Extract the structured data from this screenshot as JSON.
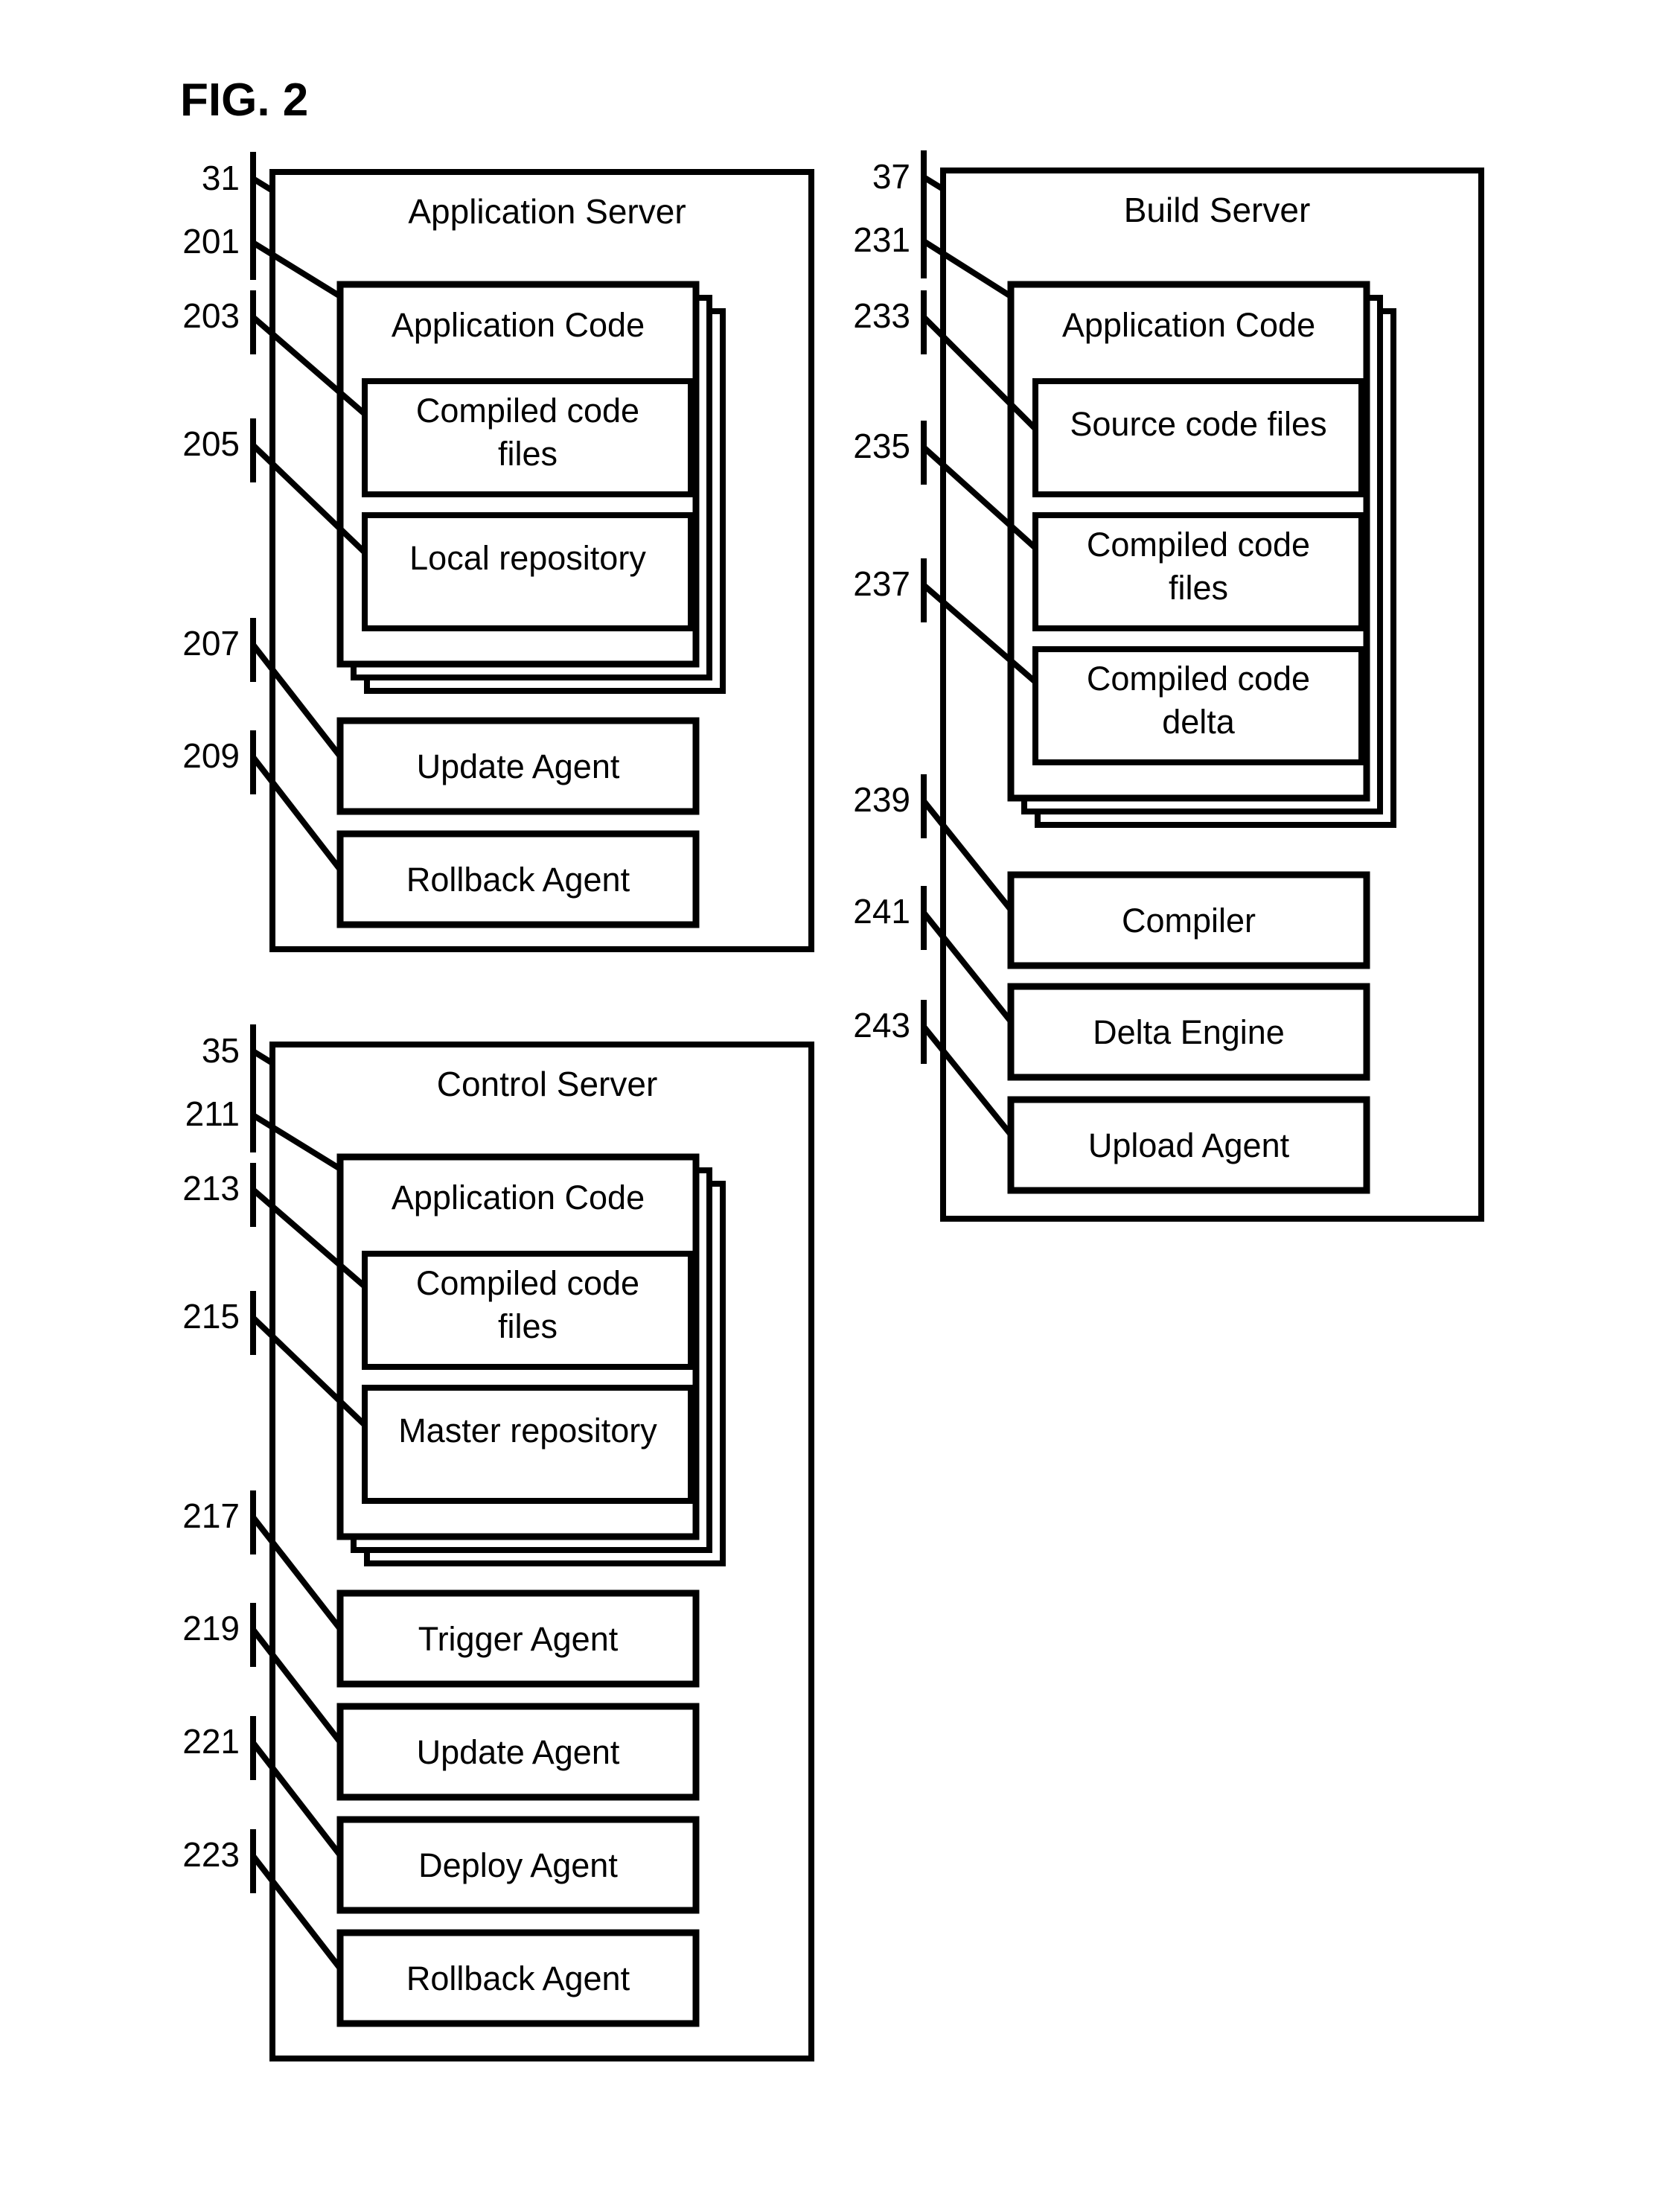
{
  "figure": {
    "title": "FIG. 2"
  },
  "servers": [
    {
      "id": "application-server",
      "title": "Application Server",
      "ref": "31",
      "appcode": {
        "label": "Application Code",
        "ref": "201",
        "children": [
          {
            "label": "Compiled code files",
            "ref": "203"
          },
          {
            "label": "Local repository",
            "ref": "205"
          }
        ]
      },
      "agents": [
        {
          "label": "Update Agent",
          "ref": "207"
        },
        {
          "label": "Rollback Agent",
          "ref": "209"
        }
      ]
    },
    {
      "id": "build-server",
      "title": "Build Server",
      "ref": "37",
      "appcode": {
        "label": "Application Code",
        "ref": "231",
        "children": [
          {
            "label": "Source code files",
            "ref": "233"
          },
          {
            "label": "Compiled code files",
            "ref": "235"
          },
          {
            "label": "Compiled code delta",
            "ref": "237"
          }
        ]
      },
      "agents": [
        {
          "label": "Compiler",
          "ref": "239"
        },
        {
          "label": "Delta Engine",
          "ref": "241"
        },
        {
          "label": "Upload Agent",
          "ref": "243"
        }
      ]
    },
    {
      "id": "control-server",
      "title": "Control Server",
      "ref": "35",
      "appcode": {
        "label": "Application Code",
        "ref": "211",
        "children": [
          {
            "label": "Compiled code files",
            "ref": "213"
          },
          {
            "label": "Master repository",
            "ref": "215"
          }
        ]
      },
      "agents": [
        {
          "label": "Trigger Agent",
          "ref": "217"
        },
        {
          "label": "Update Agent",
          "ref": "219"
        },
        {
          "label": "Deploy Agent",
          "ref": "221"
        },
        {
          "label": "Rollback Agent",
          "ref": "223"
        }
      ]
    }
  ],
  "colors": {
    "stroke": "#000000",
    "background": "#ffffff"
  }
}
